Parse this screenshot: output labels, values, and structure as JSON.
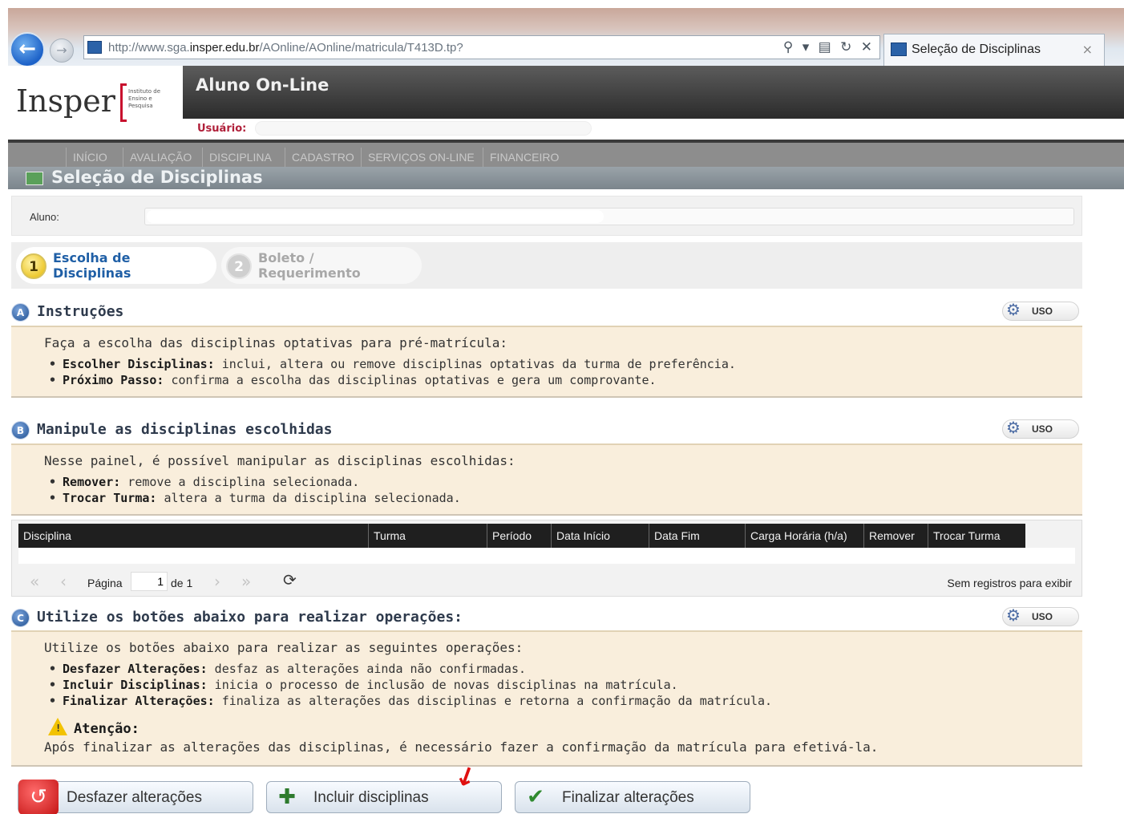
{
  "browser": {
    "url_prefix": "http://www.sga.",
    "url_domain": "insper.edu.br",
    "url_suffix": "/AOnline/AOnline/matricula/T413D.tp?",
    "tab_title": "Seleção de Disciplinas",
    "tab_close": "×",
    "tools": "⚲ ▾ ▤ ↻ ✕"
  },
  "header": {
    "logo_text": "Insper",
    "logo_institute": "Instituto de Ensino e Pesquisa",
    "app_title": "Aluno On-Line",
    "user_label": "Usuário:"
  },
  "nav": [
    "INÍCIO",
    "AVALIAÇÃO",
    "DISCIPLINA",
    "CADASTRO",
    "SERVIÇOS ON-LINE",
    "FINANCEIRO"
  ],
  "page_title": "Seleção de Disciplinas",
  "aluno_label": "Aluno:",
  "steps": [
    {
      "number": "1",
      "label_line1": "Escolha de",
      "label_line2": "Disciplinas"
    },
    {
      "number": "2",
      "label_line1": "Boleto /",
      "label_line2": "Requerimento"
    }
  ],
  "uso_label": "USO",
  "section_a": {
    "badge": "A",
    "title": "Instruções",
    "intro": "Faça a escolha das disciplinas optativas para pré-matrícula:",
    "items": [
      {
        "bold": "Escolher Disciplinas:",
        "text": " inclui, altera ou remove disciplinas optativas da turma de preferência."
      },
      {
        "bold": "Próximo Passo:",
        "text": " confirma a escolha das disciplinas optativas e gera um comprovante."
      }
    ]
  },
  "section_b": {
    "badge": "B",
    "title": "Manipule as disciplinas escolhidas",
    "intro": "Nesse painel, é possível manipular as disciplinas escolhidas:",
    "items": [
      {
        "bold": "Remover:",
        "text": " remove a disciplina selecionada."
      },
      {
        "bold": "Trocar Turma:",
        "text": " altera a turma da disciplina selecionada."
      }
    ]
  },
  "grid": {
    "columns": [
      "Disciplina",
      "Turma",
      "Período",
      "Data Início",
      "Data Fim",
      "Carga Horária (h/a)",
      "Remover",
      "Trocar Turma"
    ],
    "page_label": "Página",
    "page_value": "1",
    "of_label": "de 1",
    "empty_text": "Sem registros para exibir"
  },
  "section_c": {
    "badge": "C",
    "title": "Utilize os botões abaixo para realizar operações:",
    "intro": "Utilize os botões abaixo para realizar as seguintes operações:",
    "items": [
      {
        "bold": "Desfazer Alterações:",
        "text": " desfaz as alterações ainda não confirmadas."
      },
      {
        "bold": "Incluir Disciplinas:",
        "text": " inicia o processo de inclusão de novas disciplinas na matrícula."
      },
      {
        "bold": "Finalizar Alterações:",
        "text": " finaliza as alterações das disciplinas e retorna a confirmação da matrícula."
      }
    ],
    "attention_label": "Atenção:",
    "attention_text": "Após finalizar as alterações das disciplinas, é necessário fazer a confirmação da matrícula para efetivá-la."
  },
  "buttons": {
    "undo": "Desfazer alterações",
    "include": "Incluir disciplinas",
    "finalize": "Finalizar alterações"
  },
  "colors": {
    "accent_blue": "#1f5fa6",
    "panel_bg": "#f9eedc",
    "header_dark": "#2b2b2b",
    "annotation_red": "#e01010"
  }
}
